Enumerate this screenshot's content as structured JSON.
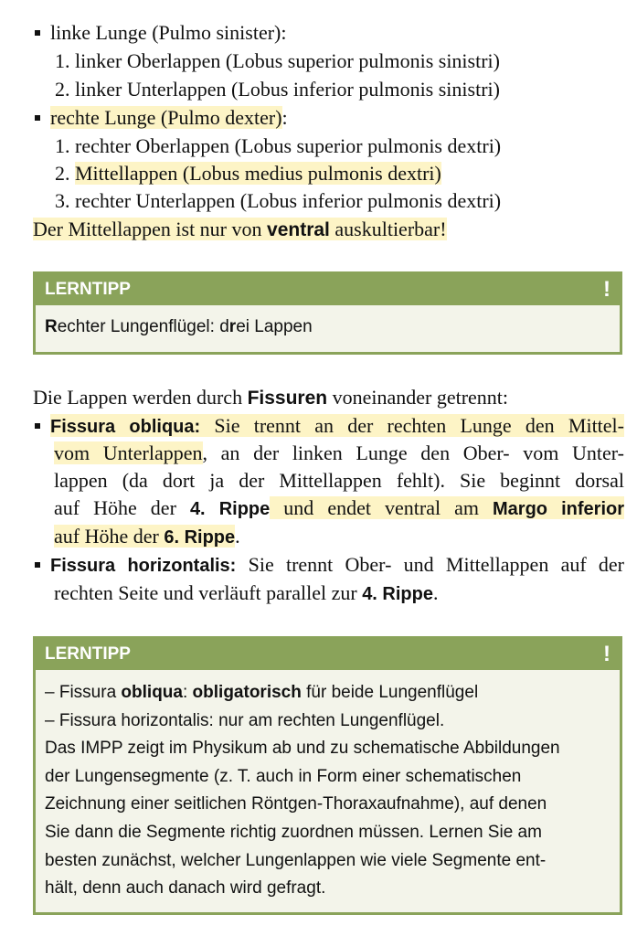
{
  "lung_list": {
    "left_lung": "linke Lunge (Pulmo sinister):",
    "left_items": [
      "1. linker Oberlappen (Lobus superior pulmonis sinistri)",
      "2. linker Unterlappen (Lobus inferior pulmonis sinistri)"
    ],
    "right_lung": "rechte Lunge (Pulmo dexter)",
    "right_lung_suffix": ":",
    "right_item_1": "1. rechter Oberlappen (Lobus superior pulmonis dextri)",
    "right_item_2_prefix": "2. ",
    "right_item_2": "Mittellappen (Lobus medius pulmonis dextri)",
    "right_item_3": "3. rechter Unterlappen (Lobus inferior pulmonis dextri)",
    "note_a": "Der Mittellappen ist nur von ",
    "note_b": "ventral",
    "note_c": " auskultierbar!"
  },
  "tip1": {
    "header": "LERNTIPP",
    "bang": "!",
    "t1": "R",
    "t2": "echter Lungenflügel: d",
    "t3": "r",
    "t4": "ei Lappen"
  },
  "fissures": {
    "intro_a": "Die Lappen werden durch ",
    "intro_b": "Fissuren",
    "intro_c": " voneinander getrennt:",
    "obl_title": "Fissura obliqua:",
    "obl_l1": " Sie trennt an der rechten Lunge den Mittel-",
    "obl_l2a": "vom Unterlappen",
    "obl_l2b": ", an der linken Lunge den Ober- vom Unter-",
    "obl_l3": "lappen (da dort ja der Mittellappen fehlt). Sie beginnt dorsal",
    "obl_l4a": "auf Höhe der ",
    "obl_l4b": "4. Rippe",
    "obl_l4c": " und endet ventral am ",
    "obl_l4d": "Margo inferior",
    "obl_l5a": "auf Höhe der ",
    "obl_l5b": "6. Rippe",
    "obl_l5c": ".",
    "hor_title": "Fissura horizontalis:",
    "hor_l1": " Sie trennt Ober- und Mittellappen auf der",
    "hor_l2a": "rechten Seite und verläuft parallel zur ",
    "hor_l2b": "4. Rippe",
    "hor_l2c": "."
  },
  "tip2": {
    "header": "LERNTIPP",
    "bang": "!",
    "l1a": "– Fissura ",
    "l1b": "obliqua",
    "l1c": ": ",
    "l1d": "obligatorisch",
    "l1e": " für beide Lungenflügel",
    "l2": "– Fissura horizontalis: nur am rechten Lungenflügel.",
    "l3": "Das IMPP zeigt im Physikum ab und zu schematische Abbildungen",
    "l4": "der Lungensegmente (z. T. auch in Form einer schematischen",
    "l5": "Zeichnung einer seitlichen Röntgen-Thoraxaufnahme), auf denen",
    "l6": "Sie dann die Segmente richtig zuordnen müssen. Lernen Sie am",
    "l7": "besten zunächst, welcher Lungenlappen wie viele Segmente ent-",
    "l8": "hält, denn auch danach wird gefragt."
  }
}
